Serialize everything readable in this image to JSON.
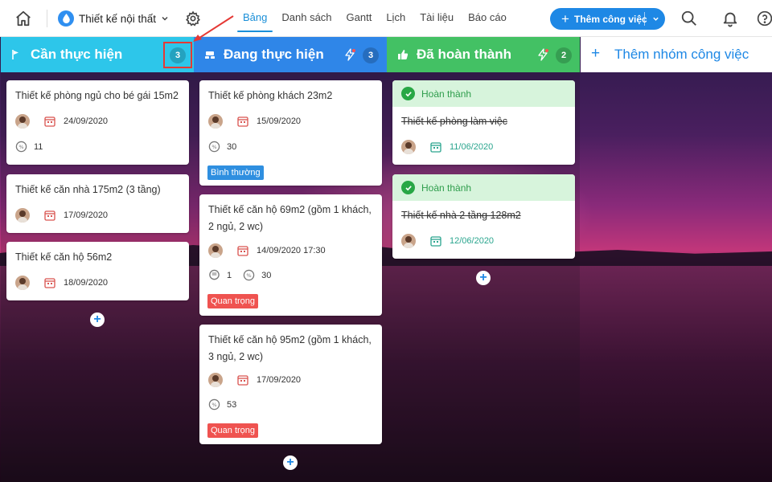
{
  "header": {
    "project_name": "Thiết kế nội thất",
    "tabs": [
      {
        "label": "Bảng",
        "active": true
      },
      {
        "label": "Danh sách"
      },
      {
        "label": "Gantt"
      },
      {
        "label": "Lịch"
      },
      {
        "label": "Tài liệu"
      },
      {
        "label": "Báo cáo"
      }
    ],
    "add_task_label": "Thêm công việc",
    "accent": "#1e88e5"
  },
  "columns": {
    "todo": {
      "title": "Cần thực hiện",
      "count": "3",
      "color": "#2dc6ea",
      "cards": [
        {
          "title": "Thiết kế phòng ngủ cho bé gái 15m2",
          "date": "24/09/2020",
          "progress": "11"
        },
        {
          "title": "Thiết kế căn nhà 175m2 (3 tầng)",
          "date": "17/09/2020"
        },
        {
          "title": "Thiết kế căn hộ 56m2",
          "date": "18/09/2020"
        }
      ]
    },
    "doing": {
      "title": "Đang thực hiện",
      "count": "3",
      "color": "#2f86e8",
      "cards": [
        {
          "title": "Thiết kế phòng khách 23m2",
          "date": "15/09/2020",
          "progress": "30",
          "tag": "Bình thường"
        },
        {
          "title": "Thiết kế căn hộ 69m2 (gồm 1 khách, 2 ngủ, 2 wc)",
          "date": "14/09/2020 17:30",
          "comments": "1",
          "progress": "30",
          "tag": "Quan trọng"
        },
        {
          "title": "Thiết kế căn hộ 95m2 (gồm 1 khách, 3 ngủ, 2 wc)",
          "date": "17/09/2020",
          "progress": "53",
          "tag": "Quan trọng"
        }
      ]
    },
    "done": {
      "title": "Đã hoàn thành",
      "count": "2",
      "color": "#43c164",
      "cards": [
        {
          "status": "Hoàn thành",
          "title": "Thiết kế phòng làm việc",
          "date": "11/06/2020"
        },
        {
          "status": "Hoàn thành",
          "title": "Thiết kế nhà 2 tầng 128m2",
          "date": "12/06/2020"
        }
      ]
    }
  },
  "new_group_label": "Thêm nhóm công việc"
}
